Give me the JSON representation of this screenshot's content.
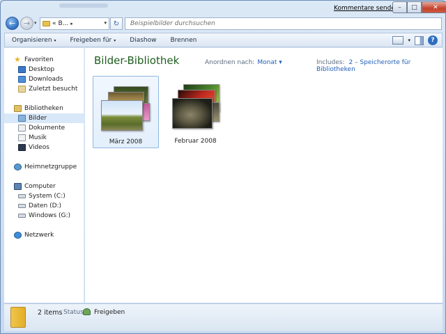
{
  "window": {
    "feedback_link": "Kommentare senden",
    "min_glyph": "–",
    "max_glyph": "□",
    "close_glyph": "✕"
  },
  "nav": {
    "back_glyph": "←",
    "forward_glyph": "→",
    "history_glyph": "▾"
  },
  "address": {
    "prefix": "«",
    "segment": "B...",
    "separator": "▸",
    "dropdown_glyph": "▾",
    "refresh_glyph": "↻"
  },
  "search": {
    "placeholder": "Beispielbilder durchsuchen"
  },
  "toolbar": {
    "organize": "Organisieren",
    "share": "Freigeben für",
    "slideshow": "Diashow",
    "burn": "Brennen",
    "dropdown_glyph": "▾",
    "help_glyph": "?"
  },
  "sidebar": {
    "favorites": "Favoriten",
    "desktop": "Desktop",
    "downloads": "Downloads",
    "recent": "Zuletzt besucht",
    "libraries": "Bibliotheken",
    "pictures": "Bilder",
    "documents": "Dokumente",
    "music": "Musik",
    "videos": "Videos",
    "homegroup": "Heimnetzgruppe",
    "computer": "Computer",
    "drive_c": "System (C:)",
    "drive_d": "Daten (D:)",
    "drive_g": "Windows (G:)",
    "network": "Netzwerk"
  },
  "main": {
    "title": "Bilder-Bibliothek",
    "arrange_label": "Anordnen nach:",
    "arrange_value": "Monat ▾",
    "includes_label": "Includes:",
    "includes_value": "2 – Speicherorte für Bibliotheken",
    "items": [
      {
        "label": "März 2008",
        "selected": true
      },
      {
        "label": "Februar 2008",
        "selected": false
      }
    ]
  },
  "status": {
    "count": "2 items",
    "label": "Status:",
    "value": "Freigeben"
  }
}
